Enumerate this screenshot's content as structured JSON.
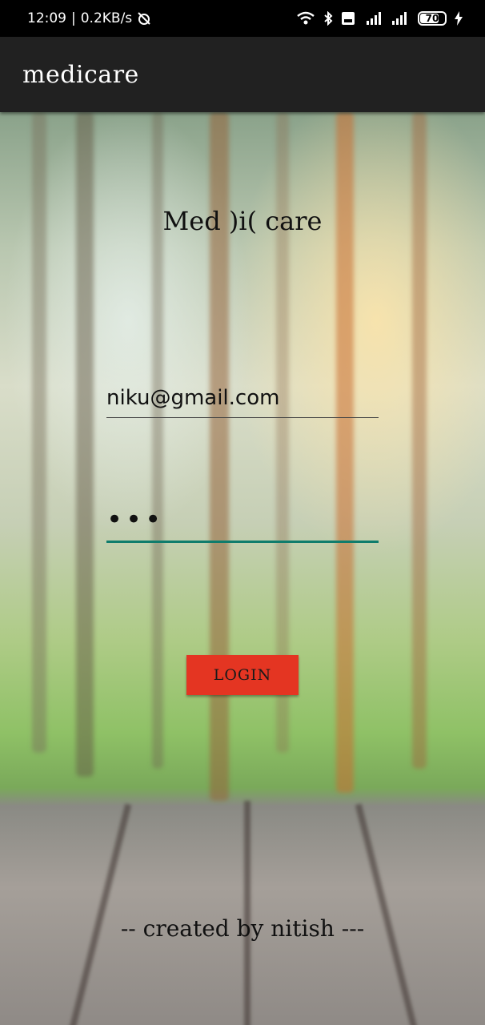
{
  "status_bar": {
    "time": "12:09",
    "network_speed": "0.2KB/s",
    "battery": "70"
  },
  "app_bar": {
    "title": "medicare"
  },
  "login": {
    "brand": "Med )i( care",
    "email_value": "niku@gmail.com",
    "password_value": "•••",
    "button_label": "LOGIN"
  },
  "footer": {
    "credit": "-- created by nitish ---"
  },
  "colors": {
    "accent": "#0f7c6c",
    "button": "#e43522",
    "app_bar": "#212121"
  }
}
